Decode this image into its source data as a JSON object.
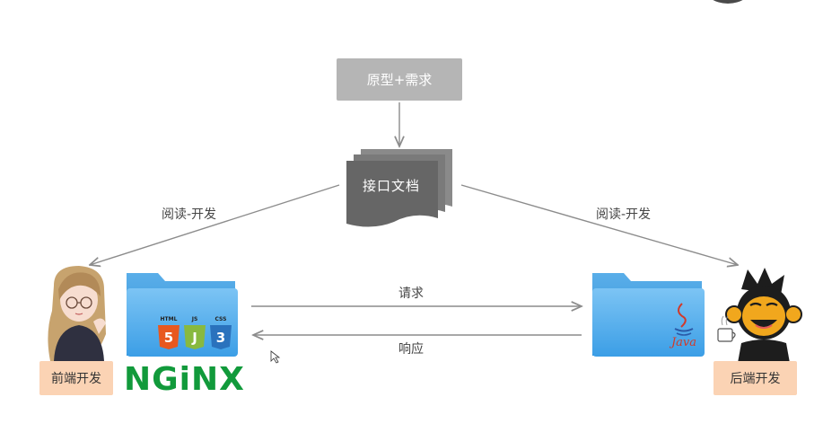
{
  "nodes": {
    "prototype": "原型+需求",
    "interface_doc": "接口文档",
    "frontend": "前端开发",
    "backend": "后端开发"
  },
  "edges": {
    "read_dev_left": "阅读-开发",
    "read_dev_right": "阅读-开发",
    "request": "请求",
    "response": "响应"
  },
  "logos": {
    "nginx": "NGiNX",
    "html": "HTML",
    "js": "JS",
    "css": "CSS",
    "java": "Java"
  },
  "colors": {
    "arrow": "#8c8c8c",
    "doc_fill": "#6b6b6b",
    "proto_fill": "#b5b5b5",
    "folder_blue": "#5ab0ec",
    "badge": "#fbd3b4",
    "nginx_green": "#119a3b"
  },
  "icons": [
    "girl-avatar-icon",
    "monkey-avatar-icon",
    "html5-icon",
    "js-icon",
    "css3-icon",
    "java-icon",
    "folder-icon",
    "document-stack-icon"
  ]
}
